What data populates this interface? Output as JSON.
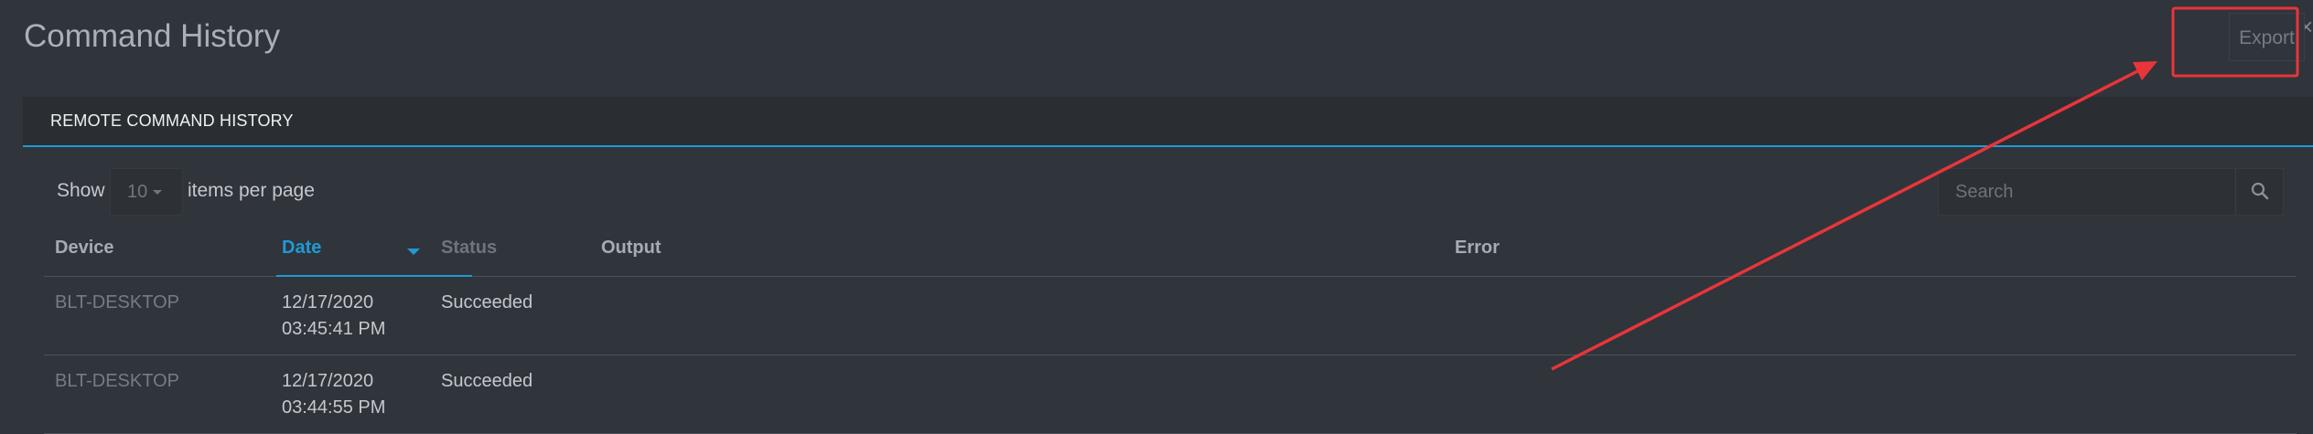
{
  "header": {
    "title": "Command History",
    "export_label": "Export",
    "close_glyph": "×"
  },
  "tabs": [
    {
      "label": "REMOTE COMMAND HISTORY",
      "active": true
    }
  ],
  "pagination": {
    "show_label": "Show",
    "page_size": "10",
    "per_page_label": "items per page"
  },
  "search": {
    "placeholder": "Search",
    "icon": "search-icon"
  },
  "table": {
    "columns": {
      "device": "Device",
      "date": "Date",
      "status": "Status",
      "output": "Output",
      "error": "Error"
    },
    "sorted_by": "date",
    "sort_direction": "descending",
    "rows": [
      {
        "device": "BLT-DESKTOP",
        "date": "12/17/2020",
        "time": "03:45:41 PM",
        "status": "Succeeded",
        "output": "",
        "error": ""
      },
      {
        "device": "BLT-DESKTOP",
        "date": "12/17/2020",
        "time": "03:44:55 PM",
        "status": "Succeeded",
        "output": "",
        "error": ""
      }
    ]
  },
  "colors": {
    "background": "#30343b",
    "accent": "#1f9ad6",
    "annotation": "#e8353a"
  }
}
